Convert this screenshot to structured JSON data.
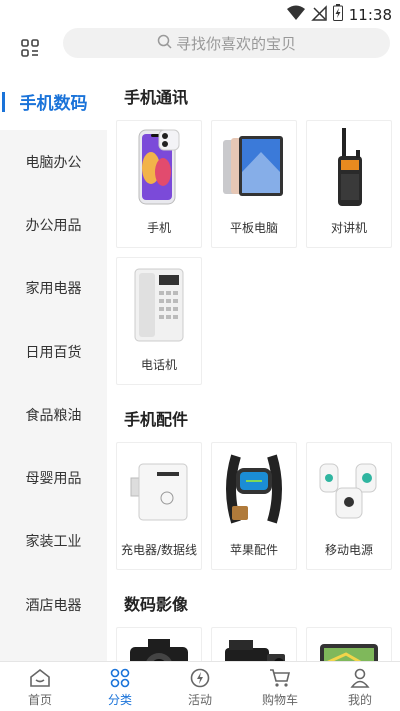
{
  "status": {
    "time": "11:38"
  },
  "search": {
    "placeholder": "寻找你喜欢的宝贝"
  },
  "sidebar": {
    "items": [
      {
        "label": "手机数码"
      },
      {
        "label": "电脑办公"
      },
      {
        "label": "办公用品"
      },
      {
        "label": "家用电器"
      },
      {
        "label": "日用百货"
      },
      {
        "label": "食品粮油"
      },
      {
        "label": "母婴用品"
      },
      {
        "label": "家装工业"
      },
      {
        "label": "酒店电器"
      }
    ]
  },
  "sections": [
    {
      "title": "手机通讯",
      "items": [
        {
          "label": "手机",
          "icon": "iphone-icon"
        },
        {
          "label": "平板电脑",
          "icon": "tablet-icon"
        },
        {
          "label": "对讲机",
          "icon": "walkie-talkie-icon"
        },
        {
          "label": "电话机",
          "icon": "desk-phone-icon"
        }
      ]
    },
    {
      "title": "手机配件",
      "items": [
        {
          "label": "充电器/数据线",
          "icon": "charger-icon"
        },
        {
          "label": "苹果配件",
          "icon": "smart-band-icon"
        },
        {
          "label": "移动电源",
          "icon": "power-bank-icon"
        }
      ]
    },
    {
      "title": "数码影像",
      "items": [
        {
          "icon": "dslr-camera-icon"
        },
        {
          "icon": "camcorder-icon"
        },
        {
          "icon": "gps-navigator-icon"
        }
      ]
    }
  ],
  "bottom_nav": [
    {
      "label": "首页",
      "icon": "home-icon"
    },
    {
      "label": "分类",
      "icon": "category-icon"
    },
    {
      "label": "活动",
      "icon": "activity-icon"
    },
    {
      "label": "购物车",
      "icon": "cart-icon"
    },
    {
      "label": "我的",
      "icon": "profile-icon"
    }
  ],
  "colors": {
    "accent": "#1a73d9",
    "sidebar_bg": "#f5f5f5"
  }
}
